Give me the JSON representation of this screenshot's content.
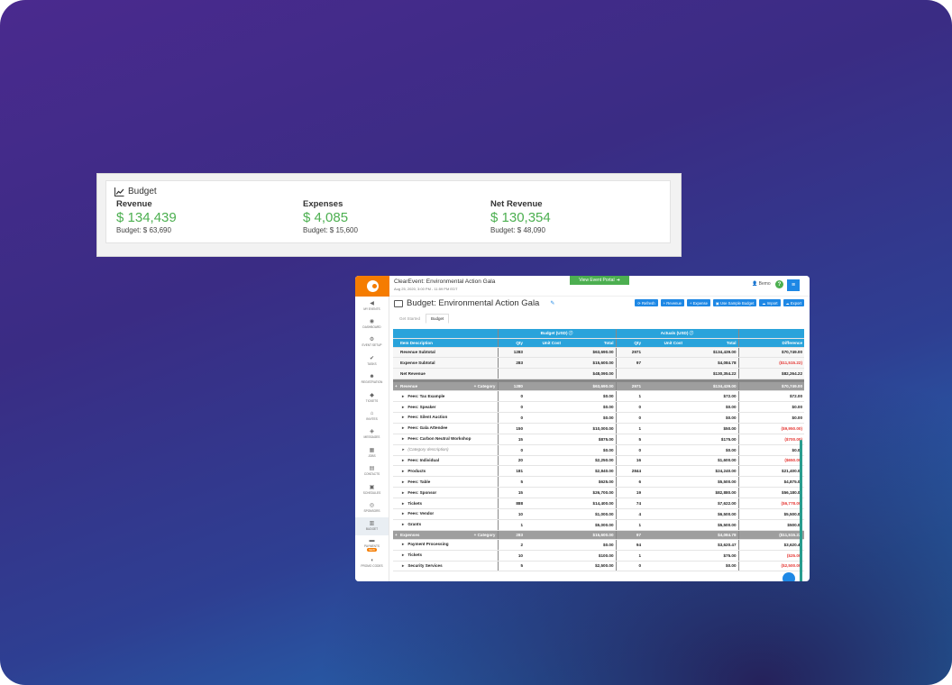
{
  "card": {
    "title": "Budget",
    "metrics": [
      {
        "label": "Revenue",
        "value": "$ 134,439",
        "budget": "Budget: $ 63,690"
      },
      {
        "label": "Expenses",
        "value": "$ 4,085",
        "budget": "Budget: $ 15,600"
      },
      {
        "label": "Net Revenue",
        "value": "$ 130,354",
        "budget": "Budget: $ 48,090"
      }
    ]
  },
  "app": {
    "event_title": "ClearEvent: Environmental Action Gala",
    "event_date": "Aug 25, 2020, 3:00 PM - 11:59 PM EDT",
    "portal_button": "View Event Portal",
    "user": "Bemo",
    "help": "?",
    "menu": "≡",
    "page_title": "Budget: Environmental Action Gala",
    "toolbar": [
      "Refresh",
      "Revenue",
      "Expense",
      "Use Sample Budget",
      "Import",
      "Export"
    ],
    "tabs": [
      "Get Started",
      "Budget"
    ],
    "nav": [
      {
        "label": "My Events",
        "icon": "arrow-left-icon",
        "glyph": "◀"
      },
      {
        "label": "Dashboard",
        "icon": "dashboard-icon",
        "glyph": "◉"
      },
      {
        "label": "Event Setup",
        "icon": "settings-icon",
        "glyph": "⚙"
      },
      {
        "label": "Tasks",
        "icon": "check-icon",
        "glyph": "✔"
      },
      {
        "label": "Registration",
        "icon": "people-icon",
        "glyph": "☻"
      },
      {
        "label": "Tickets",
        "icon": "ticket-icon",
        "glyph": "◆"
      },
      {
        "label": "Invites",
        "icon": "invite-icon",
        "glyph": "⌂"
      },
      {
        "label": "Messages",
        "icon": "message-icon",
        "glyph": "◈"
      },
      {
        "label": "Jobs",
        "icon": "jobs-icon",
        "glyph": "▦"
      },
      {
        "label": "Contacts",
        "icon": "contacts-icon",
        "glyph": "▤"
      },
      {
        "label": "Schedules",
        "icon": "calendar-icon",
        "glyph": "▣"
      },
      {
        "label": "Sponsors",
        "icon": "sponsor-icon",
        "glyph": "◎"
      },
      {
        "label": "Budget",
        "icon": "budget-icon",
        "glyph": "▥"
      },
      {
        "label": "Payments",
        "icon": "payments-icon",
        "glyph": "▬",
        "badge": "NEW"
      },
      {
        "label": "Promo Codes",
        "icon": "promo-icon",
        "glyph": "◖"
      }
    ],
    "table": {
      "group_budget": "Budget (USD)",
      "group_actuals": "Actuals (USD)",
      "headers": {
        "desc": "Item Description",
        "qty": "Qty",
        "unit": "Unit Cost",
        "total": "Total",
        "aqty": "Qty",
        "aunit": "Unit Cost",
        "atotal": "Total",
        "diff": "Difference"
      },
      "category_label": "Category",
      "summary": [
        {
          "desc": "Revenue Subtotal",
          "qty": "1283",
          "total": "$63,690.00",
          "aqty": "2971",
          "atotal": "$134,439.00",
          "diff": "$70,749.00",
          "neg": false
        },
        {
          "desc": "Expense Subtotal",
          "qty": "283",
          "total": "$15,600.00",
          "aqty": "97",
          "atotal": "$4,084.78",
          "diff": "($11,515.22)",
          "neg": true
        },
        {
          "desc": "Net Revenue",
          "qty": "",
          "total": "$48,090.00",
          "aqty": "",
          "atotal": "$130,354.22",
          "diff": "$82,264.22",
          "neg": false
        }
      ],
      "revenue_cat": {
        "desc": "Revenue",
        "qty": "1280",
        "total": "$63,690.00",
        "aqty": "2971",
        "atotal": "$134,439.00",
        "diff": "$70,749.00"
      },
      "revenue_rows": [
        {
          "desc": "Fees: Tax Example",
          "qty": "0",
          "total": "$0.00",
          "aqty": "1",
          "atotal": "$72.00",
          "diff": "$72.00",
          "neg": false
        },
        {
          "desc": "Fees: Speaker",
          "qty": "0",
          "total": "$0.00",
          "aqty": "0",
          "atotal": "$0.00",
          "diff": "$0.00",
          "neg": false
        },
        {
          "desc": "Fees: Silent Auction",
          "qty": "0",
          "total": "$0.00",
          "aqty": "0",
          "atotal": "$0.00",
          "diff": "$0.00",
          "neg": false
        },
        {
          "desc": "Fees: Gala Attendee",
          "qty": "150",
          "total": "$10,000.00",
          "aqty": "1",
          "atotal": "$50.00",
          "diff": "($9,950.00)",
          "neg": true
        },
        {
          "desc": "Fees: Carbon Neutral Workshop",
          "qty": "15",
          "total": "$875.00",
          "aqty": "5",
          "atotal": "$175.00",
          "diff": "($700.00)",
          "neg": true
        },
        {
          "desc": "(Category description)",
          "qty": "0",
          "total": "$0.00",
          "aqty": "0",
          "atotal": "$0.00",
          "diff": "$0.00",
          "neg": false,
          "italic": true
        },
        {
          "desc": "Fees: Individual",
          "qty": "20",
          "total": "$2,250.00",
          "aqty": "16",
          "atotal": "$1,600.00",
          "diff": "($650.00)",
          "neg": true
        },
        {
          "desc": "Products",
          "qty": "181",
          "total": "$2,840.00",
          "aqty": "2844",
          "atotal": "$24,240.00",
          "diff": "$21,400.00",
          "neg": false
        },
        {
          "desc": "Fees: Table",
          "qty": "5",
          "total": "$625.00",
          "aqty": "6",
          "atotal": "$5,500.00",
          "diff": "$4,875.00",
          "neg": false
        },
        {
          "desc": "Fees: Sponsor",
          "qty": "15",
          "total": "$26,700.00",
          "aqty": "19",
          "atotal": "$82,880.00",
          "diff": "$56,180.00",
          "neg": false
        },
        {
          "desc": "Tickets",
          "qty": "888",
          "total": "$14,400.00",
          "aqty": "74",
          "atotal": "$7,622.00",
          "diff": "($6,778.00)",
          "neg": true
        },
        {
          "desc": "Fees: Vendor",
          "qty": "10",
          "total": "$1,000.00",
          "aqty": "4",
          "atotal": "$6,500.00",
          "diff": "$5,500.00",
          "neg": false
        },
        {
          "desc": "Grants",
          "qty": "1",
          "total": "$5,000.00",
          "aqty": "1",
          "atotal": "$5,500.00",
          "diff": "$500.00",
          "neg": false
        }
      ],
      "expense_cat": {
        "desc": "Expenses",
        "qty": "283",
        "total": "$15,600.00",
        "aqty": "97",
        "atotal": "$4,084.78",
        "diff": "($11,515.22)"
      },
      "expense_rows": [
        {
          "desc": "Payment Processing",
          "qty": "2",
          "total": "$0.00",
          "aqty": "94",
          "atotal": "$3,620.47",
          "diff": "$3,620.47",
          "neg": false
        },
        {
          "desc": "Tickets",
          "qty": "10",
          "total": "$100.00",
          "aqty": "1",
          "atotal": "$75.00",
          "diff": "($25.00)",
          "neg": true
        },
        {
          "desc": "Security Services",
          "qty": "5",
          "total": "$2,500.00",
          "aqty": "0",
          "atotal": "$0.00",
          "diff": "($2,500.00)",
          "neg": true
        }
      ]
    }
  },
  "colors": {
    "revenue_green": "#4caf50",
    "primary_blue": "#1e88e5",
    "header_blue": "#29a3db",
    "brand_orange": "#f57c00",
    "negative_red": "#e53935"
  }
}
